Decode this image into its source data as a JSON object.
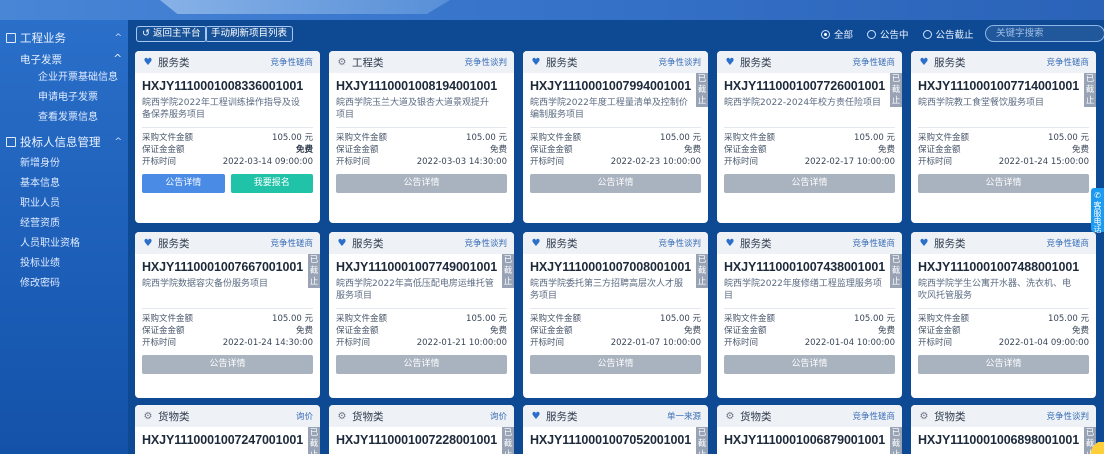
{
  "sidebar": {
    "group1": {
      "label": "工程业务",
      "sub": {
        "label": "电子发票",
        "items": [
          "企业开票基础信息",
          "申请电子发票",
          "查看发票信息"
        ]
      }
    },
    "group2": {
      "label": "投标人信息管理",
      "items": [
        "新增身份",
        "基本信息",
        "职业人员",
        "经营资质",
        "人员职业资格",
        "投标业绩",
        "修改密码"
      ]
    }
  },
  "toolbar": {
    "back_label": "返回主平台",
    "refresh_label": "手动刷新项目列表",
    "filter": {
      "all": "全部",
      "announcing": "公告中",
      "closed": "公告截止",
      "selected": "all"
    },
    "search_placeholder": "关键字搜索"
  },
  "labels": {
    "purchase_fee": "采购文件金额",
    "deposit": "保证金金额",
    "open_time": "开标时间",
    "detail_btn": "公告详情",
    "signup_btn": "我要报名",
    "closed_stamp": "已截止"
  },
  "right_tab": "客服电话",
  "accent_color": "#2a6fc9",
  "cards": [
    {
      "category": "服务类",
      "icon": "heart-icon",
      "method": "竞争性磋商",
      "code": "HXJY1110001008336001001",
      "name": "皖西学院2022年工程训练操作指导及设备保养服务项目",
      "fee": "105.00 元",
      "deposit": "免费",
      "time": "2022-03-14 09:00:00",
      "closed": false
    },
    {
      "category": "工程类",
      "icon": "gear-icon",
      "method": "竞争性谈判",
      "code": "HXJY1110001008194001001",
      "name": "皖西学院玉兰大道及银杏大道景观提升项目",
      "fee": "105.00 元",
      "deposit": "免费",
      "time": "2022-03-03 14:30:00",
      "closed": false
    },
    {
      "category": "服务类",
      "icon": "heart-icon",
      "method": "竞争性谈判",
      "code": "HXJY1110001007994001001",
      "name": "皖西学院2022年度工程量清单及控制价编制服务项目",
      "fee": "105.00 元",
      "deposit": "免费",
      "time": "2022-02-23 10:00:00",
      "closed": true
    },
    {
      "category": "服务类",
      "icon": "heart-icon",
      "method": "竞争性磋商",
      "code": "HXJY1110001007726001001",
      "name": "皖西学院2022-2024年校方责任险项目",
      "fee": "105.00 元",
      "deposit": "免费",
      "time": "2022-02-17 10:00:00",
      "closed": true
    },
    {
      "category": "服务类",
      "icon": "heart-icon",
      "method": "竞争性磋商",
      "code": "HXJY1110001007714001001",
      "name": "皖西学院教工食堂餐饮服务项目",
      "fee": "105.00 元",
      "deposit": "免费",
      "time": "2022-01-24 15:00:00",
      "closed": true
    },
    {
      "category": "服务类",
      "icon": "heart-icon",
      "method": "竞争性磋商",
      "code": "HXJY1110001007667001001",
      "name": "皖西学院数据容灾备份服务项目",
      "fee": "105.00 元",
      "deposit": "免费",
      "time": "2022-01-24 14:30:00",
      "closed": true
    },
    {
      "category": "服务类",
      "icon": "heart-icon",
      "method": "竞争性谈判",
      "code": "HXJY1110001007749001001",
      "name": "皖西学院2022年高低压配电房运维托管服务项目",
      "fee": "105.00 元",
      "deposit": "免费",
      "time": "2022-01-21 10:00:00",
      "closed": true
    },
    {
      "category": "服务类",
      "icon": "heart-icon",
      "method": "竞争性谈判",
      "code": "HXJY1110001007008001001",
      "name": "皖西学院委托第三方招聘高层次人才服务项目",
      "fee": "105.00 元",
      "deposit": "免费",
      "time": "2022-01-07 10:00:00",
      "closed": true
    },
    {
      "category": "服务类",
      "icon": "heart-icon",
      "method": "竞争性磋商",
      "code": "HXJY1110001007438001001",
      "name": "皖西学院2022年度修缮工程监理服务项目",
      "fee": "105.00 元",
      "deposit": "免费",
      "time": "2022-01-04 10:00:00",
      "closed": true
    },
    {
      "category": "服务类",
      "icon": "heart-icon",
      "method": "竞争性磋商",
      "code": "HXJY1110001007488001001",
      "name": "皖西学院学生公寓开水器、洗衣机、电吹风托管服务",
      "fee": "105.00 元",
      "deposit": "免费",
      "time": "2022-01-04 09:00:00",
      "closed": false
    },
    {
      "category": "货物类",
      "icon": "gear-icon",
      "method": "询价",
      "code": "HXJY1110001007247001001",
      "name": "",
      "fee": "",
      "deposit": "",
      "time": "",
      "closed": true
    },
    {
      "category": "货物类",
      "icon": "gear-icon",
      "method": "询价",
      "code": "HXJY1110001007228001001",
      "name": "",
      "fee": "",
      "deposit": "",
      "time": "",
      "closed": true
    },
    {
      "category": "服务类",
      "icon": "heart-icon",
      "method": "单一来源",
      "code": "HXJY1110001007052001001",
      "name": "",
      "fee": "",
      "deposit": "",
      "time": "",
      "closed": true
    },
    {
      "category": "货物类",
      "icon": "gear-icon",
      "method": "竞争性磋商",
      "code": "HXJY1110001006879001001",
      "name": "",
      "fee": "",
      "deposit": "",
      "time": "",
      "closed": true
    },
    {
      "category": "货物类",
      "icon": "gear-icon",
      "method": "竞争性谈判",
      "code": "HXJY1110001006898001001",
      "name": "",
      "fee": "",
      "deposit": "",
      "time": "",
      "closed": true
    }
  ]
}
